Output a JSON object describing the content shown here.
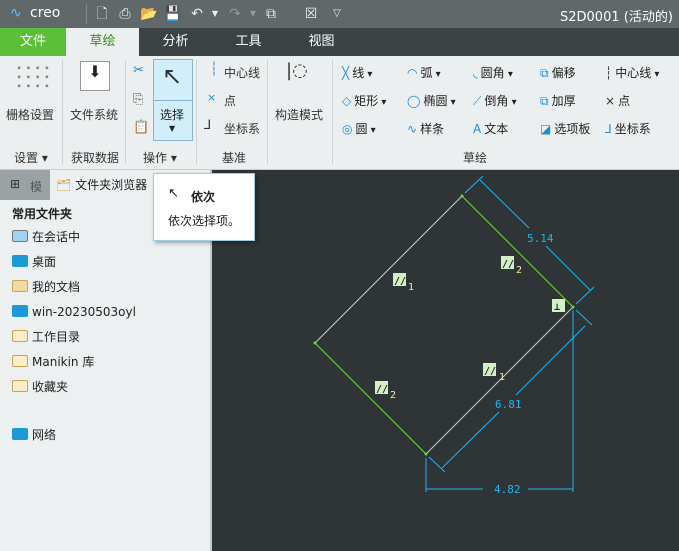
{
  "titlebar": {
    "logo": "creo",
    "title": "S2D0001 (活动的) -"
  },
  "tabs": [
    {
      "label": "文件"
    },
    {
      "label": "草绘"
    },
    {
      "label": "分析"
    },
    {
      "label": "工具"
    },
    {
      "label": "视图"
    }
  ],
  "ribbon": {
    "grid_settings": "栅格设置",
    "group_settings": "设置",
    "file_system": "文件系统",
    "group_getdata": "获取数据",
    "select": "选择",
    "group_operations": "操作",
    "centerline": "中心线",
    "point": "点",
    "coord_sys": "坐标系",
    "group_datum": "基准",
    "construction_mode": "构造模式",
    "sketch_tools": [
      [
        "线",
        "弧",
        "圆角",
        "偏移",
        "中心线"
      ],
      [
        "矩形",
        "椭圆",
        "倒角",
        "加厚",
        "点"
      ],
      [
        "圆",
        "样条",
        "文本",
        "选项板",
        "坐标系"
      ]
    ],
    "group_sketch": "草绘"
  },
  "sidebar": {
    "tab_model": "模",
    "tab_browser": "文件夹浏览器",
    "heading": "常用文件夹",
    "items": [
      {
        "label": "在会话中"
      },
      {
        "label": "桌面"
      },
      {
        "label": "我的文档"
      },
      {
        "label": "win-20230503oyl"
      },
      {
        "label": "工作目录"
      },
      {
        "label": "Manikin 库"
      },
      {
        "label": "收藏夹"
      },
      {
        "label": "网络"
      }
    ]
  },
  "tooltip": {
    "title": "依次",
    "text": "依次选择项。"
  },
  "sketch": {
    "dims": {
      "d1": "5.14",
      "d2": "6.81",
      "d3": "4.82"
    },
    "constraints": {
      "parallel": "//",
      "perp": "⊥",
      "idx1": "1",
      "idx2": "2"
    }
  },
  "colors": {
    "accent_green": "#5cbf3a",
    "dimension": "#19b8f0",
    "canvas": "#2f3536"
  }
}
